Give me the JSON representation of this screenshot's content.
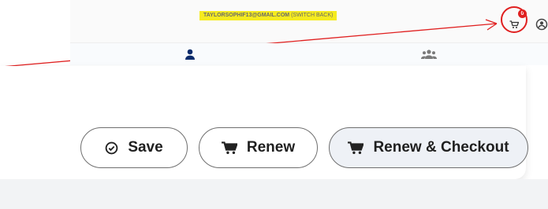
{
  "header": {
    "impersonation_email": "TAYLORSOPHIF13@GMAIL.COM",
    "switch_back_label": "(SWITCH BACK)",
    "cart_count": "0"
  },
  "nav": {
    "tabs": [
      {
        "icon": "person-icon",
        "active": true
      },
      {
        "icon": "group-icon",
        "active": false
      }
    ]
  },
  "actions": {
    "save_label": "Save",
    "renew_label": "Renew",
    "renew_checkout_label": "Renew & Checkout"
  },
  "colors": {
    "accent": "#0d2c6c",
    "annotation": "#e02020",
    "impersonation_bg": "#f5eb1f"
  }
}
